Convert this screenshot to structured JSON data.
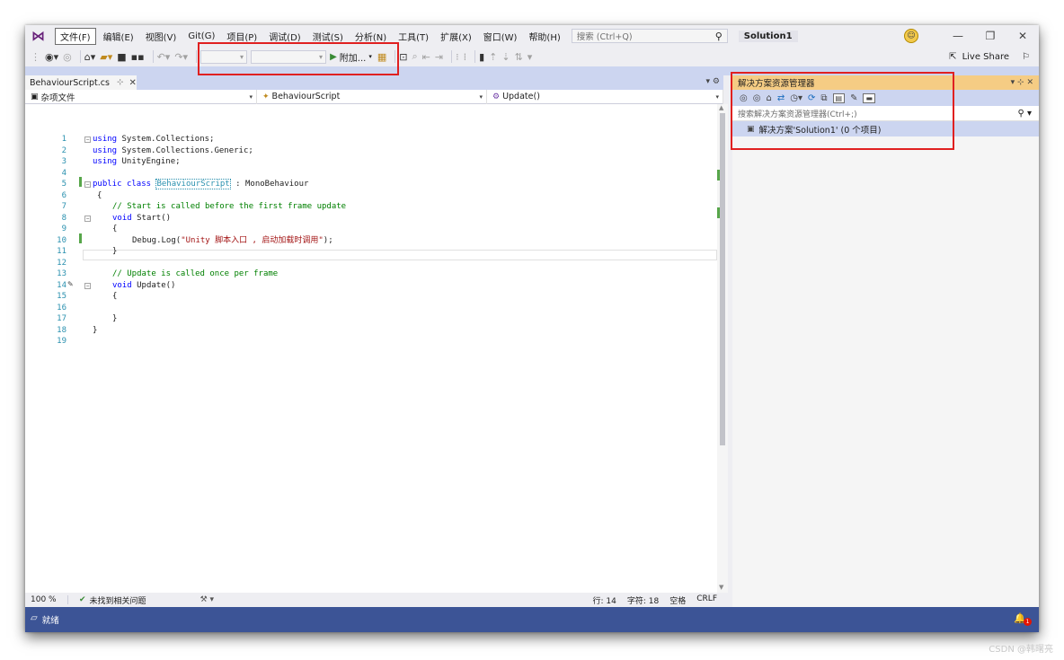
{
  "menubar": {
    "items": [
      {
        "label": "文件(F)"
      },
      {
        "label": "编辑(E)"
      },
      {
        "label": "视图(V)"
      },
      {
        "label": "Git(G)"
      },
      {
        "label": "项目(P)"
      },
      {
        "label": "调试(D)"
      },
      {
        "label": "测试(S)"
      },
      {
        "label": "分析(N)"
      },
      {
        "label": "工具(T)"
      },
      {
        "label": "扩展(X)"
      },
      {
        "label": "窗口(W)"
      },
      {
        "label": "帮助(H)"
      }
    ],
    "search_placeholder": "搜索 (Ctrl+Q)",
    "solution_name": "Solution1"
  },
  "toolbar": {
    "attach_label": "附加...",
    "live_share_label": "Live Share"
  },
  "editor": {
    "tab_label": "BehaviourScript.cs",
    "nav_project": "杂项文件",
    "nav_class": "BehaviourScript",
    "nav_member": "Update()",
    "lines": [
      {
        "n": "1"
      },
      {
        "n": "2"
      },
      {
        "n": "3"
      },
      {
        "n": "4"
      },
      {
        "n": "5"
      },
      {
        "n": "6"
      },
      {
        "n": "7"
      },
      {
        "n": "8"
      },
      {
        "n": "9"
      },
      {
        "n": "10"
      },
      {
        "n": "11"
      },
      {
        "n": "12"
      },
      {
        "n": "13"
      },
      {
        "n": "14"
      },
      {
        "n": "15"
      },
      {
        "n": "16"
      },
      {
        "n": "17"
      },
      {
        "n": "18"
      },
      {
        "n": "19"
      }
    ],
    "code": {
      "l1_kw": "using",
      "l1_rest": " System.Collections;",
      "l2_kw": "using",
      "l2_rest": " System.Collections.Generic;",
      "l3_kw": "using",
      "l3_rest": " UnityEngine;",
      "l5_kw1": "public",
      "l5_kw2": "class",
      "l5_type": "BehaviourScript",
      "l5_rest": " : MonoBehaviour",
      "l6": "{",
      "l7": "// Start is called before the first frame update",
      "l8_kw": "void",
      "l8_rest": " Start()",
      "l9": "{",
      "l10_pre": "Debug.Log(",
      "l10_str": "\"Unity 脚本入口 , 启动加载时调用\"",
      "l10_post": ");",
      "l11": "}",
      "l13": "// Update is called once per frame",
      "l14_kw": "void",
      "l14_rest": " Update()",
      "l15": "{",
      "l17": "}",
      "l18": "}"
    }
  },
  "status": {
    "zoom": "100 %",
    "issues": "未找到相关问题",
    "line": "行: 14",
    "char": "字符: 18",
    "spaces": "空格",
    "eol": "CRLF",
    "ready": "就绪"
  },
  "solution_explorer": {
    "title": "解决方案资源管理器",
    "search_placeholder": "搜索解决方案资源管理器(Ctrl+;)",
    "root_item": "解决方案'Solution1' (0 个项目)"
  },
  "watermark": "CSDN @韩曙亮",
  "colors": {
    "accent": "#3c5496",
    "highlight": "#e02020",
    "tool_window_title": "#f5cc84"
  }
}
